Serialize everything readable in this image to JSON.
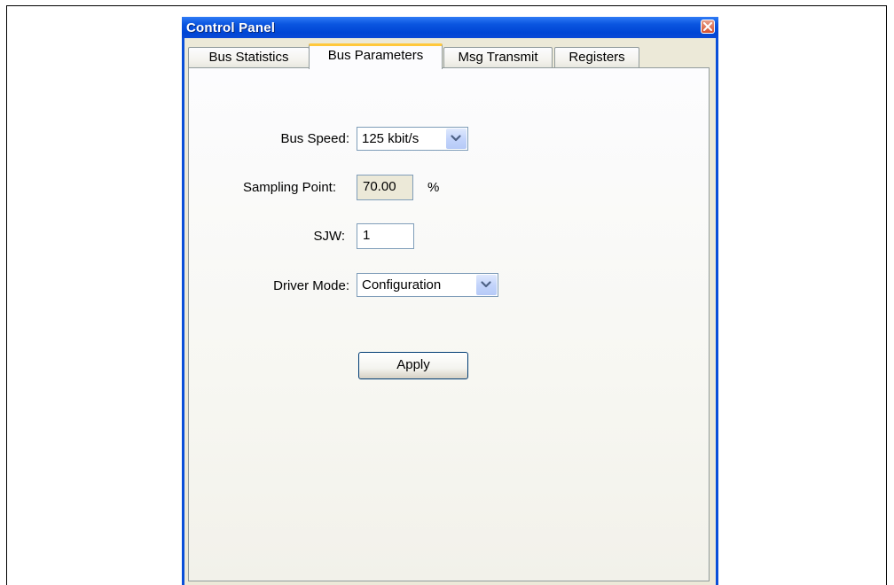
{
  "window": {
    "title": "Control Panel",
    "title_bar_color": "#0a4fd9",
    "close_icon": "close-icon"
  },
  "tabs": [
    {
      "label": "Bus Statistics",
      "active": false
    },
    {
      "label": "Bus Parameters",
      "active": true
    },
    {
      "label": "Msg Transmit",
      "active": false
    },
    {
      "label": "Registers",
      "active": false
    }
  ],
  "form": {
    "bus_speed": {
      "label": "Bus Speed:",
      "value": "125 kbit/s"
    },
    "sampling_point": {
      "label": "Sampling Point:",
      "value": "70.00",
      "unit": "%"
    },
    "sjw": {
      "label": "SJW:",
      "value": "1"
    },
    "driver_mode": {
      "label": "Driver Mode:",
      "value": "Configuration"
    },
    "apply_label": "Apply"
  }
}
